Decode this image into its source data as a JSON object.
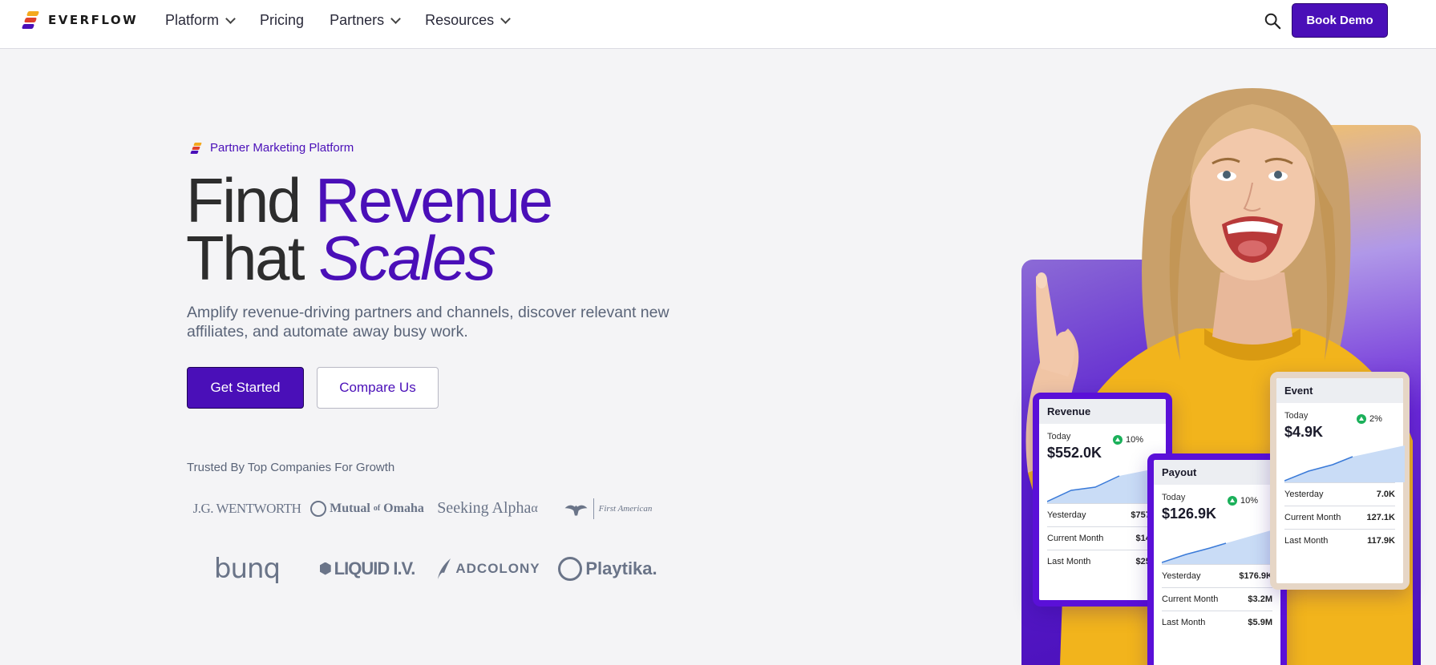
{
  "nav": {
    "brand": "EVERFLOW",
    "items": [
      {
        "label": "Platform",
        "dropdown": true
      },
      {
        "label": "Pricing",
        "dropdown": false
      },
      {
        "label": "Partners",
        "dropdown": true
      },
      {
        "label": "Resources",
        "dropdown": true
      }
    ],
    "cta": "Book Demo"
  },
  "hero": {
    "badge": "Partner Marketing Platform",
    "headline_1a": "Find ",
    "headline_1b": "Revenue",
    "headline_2a": "That ",
    "headline_2b": "Scales",
    "subtext": "Amplify revenue-driving partners and channels, discover relevant new affiliates, and automate away busy work.",
    "primary_cta": "Get Started",
    "secondary_cta": "Compare Us",
    "trusted_label": "Trusted By Top Companies For Growth",
    "logos": [
      "JG Wentworth",
      "Mutual of Omaha",
      "Seeking Alpha",
      "First American",
      "bunq",
      "LIQUID I.V.",
      "AdColony",
      "Playtika"
    ]
  },
  "cards": {
    "revenue": {
      "title": "Revenue",
      "today_label": "Today",
      "today": "$552.0K",
      "change": "10%",
      "rows": [
        {
          "label": "Yesterday",
          "value": "$757.4"
        },
        {
          "label": "Current Month",
          "value": "$14.1"
        },
        {
          "label": "Last Month",
          "value": "$25.9"
        }
      ]
    },
    "payout": {
      "title": "Payout",
      "today_label": "Today",
      "today": "$126.9K",
      "change": "10%",
      "rows": [
        {
          "label": "Yesterday",
          "value": "$176.9K"
        },
        {
          "label": "Current Month",
          "value": "$3.2M"
        },
        {
          "label": "Last Month",
          "value": "$5.9M"
        }
      ]
    },
    "event": {
      "title": "Event",
      "today_label": "Today",
      "today": "$4.9K",
      "change": "2%",
      "rows": [
        {
          "label": "Yesterday",
          "value": "7.0K"
        },
        {
          "label": "Current Month",
          "value": "127.1K"
        },
        {
          "label": "Last Month",
          "value": "117.9K"
        }
      ]
    }
  },
  "colors": {
    "brand_purple": "#4a0fb8",
    "accent_yellow": "#f4a91e",
    "accent_red": "#e0412c",
    "up_green": "#1bb05a"
  }
}
